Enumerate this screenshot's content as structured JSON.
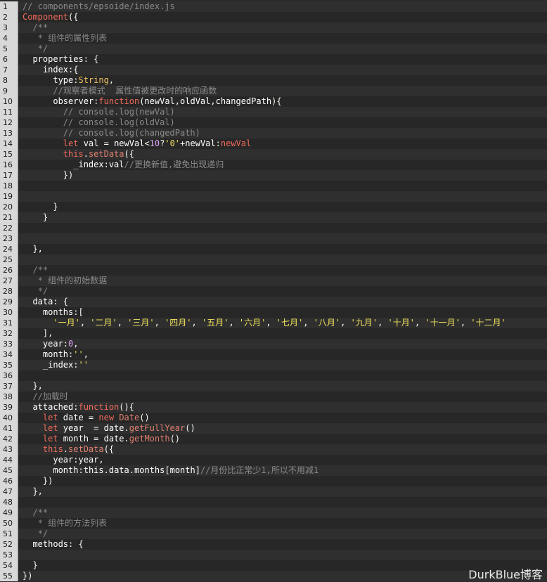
{
  "editor": {
    "lines": [
      {
        "n": "1",
        "tokens": [
          [
            "c",
            "// components/epsoide/index.js"
          ]
        ]
      },
      {
        "n": "2",
        "tokens": [
          [
            "k",
            "Component"
          ],
          [
            "p",
            "({"
          ]
        ]
      },
      {
        "n": "3",
        "tokens": [
          [
            "c",
            "  /**"
          ]
        ]
      },
      {
        "n": "4",
        "tokens": [
          [
            "c",
            "   * 组件的属性列表"
          ]
        ]
      },
      {
        "n": "5",
        "tokens": [
          [
            "c",
            "   */"
          ]
        ]
      },
      {
        "n": "6",
        "tokens": [
          [
            "v",
            "  properties"
          ],
          [
            "p",
            ": {"
          ]
        ]
      },
      {
        "n": "7",
        "tokens": [
          [
            "v",
            "    index"
          ],
          [
            "p",
            ":{"
          ]
        ]
      },
      {
        "n": "8",
        "tokens": [
          [
            "v",
            "      type"
          ],
          [
            "p",
            ":"
          ],
          [
            "t",
            "String"
          ],
          [
            "p",
            ","
          ]
        ]
      },
      {
        "n": "9",
        "tokens": [
          [
            "c",
            "      //观察者模式  属性值被更改时的响应函数"
          ]
        ]
      },
      {
        "n": "10",
        "tokens": [
          [
            "v",
            "      observer"
          ],
          [
            "p",
            ":"
          ],
          [
            "k",
            "function"
          ],
          [
            "p",
            "("
          ],
          [
            "v",
            "newVal"
          ],
          [
            "p",
            ","
          ],
          [
            "v",
            "oldVal"
          ],
          [
            "p",
            ","
          ],
          [
            "v",
            "changedPath"
          ],
          [
            "p",
            "){"
          ]
        ]
      },
      {
        "n": "11",
        "tokens": [
          [
            "c",
            "        // console.log(newVal)"
          ]
        ]
      },
      {
        "n": "12",
        "tokens": [
          [
            "c",
            "        // console.log(oldVal)"
          ]
        ]
      },
      {
        "n": "13",
        "tokens": [
          [
            "c",
            "        // console.log(changedPath)"
          ]
        ]
      },
      {
        "n": "14",
        "tokens": [
          [
            "k",
            "        let"
          ],
          [
            "v",
            " val"
          ],
          [
            "p",
            " = "
          ],
          [
            "v",
            "newVal"
          ],
          [
            "p",
            "<"
          ],
          [
            "n",
            "10"
          ],
          [
            "p",
            "?"
          ],
          [
            "s",
            "'0'"
          ],
          [
            "p",
            "+"
          ],
          [
            "v",
            "newVal"
          ],
          [
            "p",
            ":"
          ],
          [
            "k",
            "newVal"
          ]
        ]
      },
      {
        "n": "15",
        "tokens": [
          [
            "k",
            "        this"
          ],
          [
            "p",
            "."
          ],
          [
            "f",
            "setData"
          ],
          [
            "p",
            "({"
          ]
        ]
      },
      {
        "n": "16",
        "tokens": [
          [
            "v",
            "          _index"
          ],
          [
            "p",
            ":"
          ],
          [
            "v",
            "val"
          ],
          [
            "c",
            "//更换新值,避免出现递归"
          ]
        ]
      },
      {
        "n": "17",
        "tokens": [
          [
            "p",
            "        })"
          ]
        ]
      },
      {
        "n": "18",
        "tokens": []
      },
      {
        "n": "19",
        "tokens": []
      },
      {
        "n": "20",
        "tokens": [
          [
            "p",
            "      }"
          ]
        ]
      },
      {
        "n": "21",
        "tokens": [
          [
            "p",
            "    }"
          ]
        ]
      },
      {
        "n": "22",
        "tokens": []
      },
      {
        "n": "23",
        "tokens": []
      },
      {
        "n": "24",
        "tokens": [
          [
            "p",
            "  },"
          ]
        ]
      },
      {
        "n": "25",
        "tokens": []
      },
      {
        "n": "26",
        "tokens": [
          [
            "c",
            "  /**"
          ]
        ]
      },
      {
        "n": "27",
        "tokens": [
          [
            "c",
            "   * 组件的初始数据"
          ]
        ]
      },
      {
        "n": "28",
        "tokens": [
          [
            "c",
            "   */"
          ]
        ]
      },
      {
        "n": "29",
        "tokens": [
          [
            "v",
            "  data"
          ],
          [
            "p",
            ": {"
          ]
        ]
      },
      {
        "n": "30",
        "tokens": [
          [
            "v",
            "    months"
          ],
          [
            "p",
            ":["
          ]
        ]
      },
      {
        "n": "31",
        "tokens": [
          [
            "s",
            "      '一月'"
          ],
          [
            "p",
            ", "
          ],
          [
            "s",
            "'二月'"
          ],
          [
            "p",
            ", "
          ],
          [
            "s",
            "'三月'"
          ],
          [
            "p",
            ", "
          ],
          [
            "s",
            "'四月'"
          ],
          [
            "p",
            ", "
          ],
          [
            "s",
            "'五月'"
          ],
          [
            "p",
            ", "
          ],
          [
            "s",
            "'六月'"
          ],
          [
            "p",
            ", "
          ],
          [
            "s",
            "'七月'"
          ],
          [
            "p",
            ", "
          ],
          [
            "s",
            "'八月'"
          ],
          [
            "p",
            ", "
          ],
          [
            "s",
            "'九月'"
          ],
          [
            "p",
            ", "
          ],
          [
            "s",
            "'十月'"
          ],
          [
            "p",
            ", "
          ],
          [
            "s",
            "'十一月'"
          ],
          [
            "p",
            ", "
          ],
          [
            "s",
            "'十二月'"
          ]
        ]
      },
      {
        "n": "32",
        "tokens": [
          [
            "p",
            "    ],"
          ]
        ]
      },
      {
        "n": "33",
        "tokens": [
          [
            "v",
            "    year"
          ],
          [
            "p",
            ":"
          ],
          [
            "n",
            "0"
          ],
          [
            "p",
            ","
          ]
        ]
      },
      {
        "n": "34",
        "tokens": [
          [
            "v",
            "    month"
          ],
          [
            "p",
            ":"
          ],
          [
            "s",
            "''"
          ],
          [
            "p",
            ","
          ]
        ]
      },
      {
        "n": "35",
        "tokens": [
          [
            "v",
            "    _index"
          ],
          [
            "p",
            ":"
          ],
          [
            "s",
            "''"
          ]
        ]
      },
      {
        "n": "36",
        "tokens": []
      },
      {
        "n": "37",
        "tokens": [
          [
            "p",
            "  },"
          ]
        ]
      },
      {
        "n": "38",
        "tokens": [
          [
            "c",
            "  //加载时"
          ]
        ]
      },
      {
        "n": "39",
        "tokens": [
          [
            "v",
            "  attached"
          ],
          [
            "p",
            ":"
          ],
          [
            "k",
            "function"
          ],
          [
            "p",
            "(){"
          ]
        ]
      },
      {
        "n": "40",
        "tokens": [
          [
            "k",
            "    let"
          ],
          [
            "v",
            " date"
          ],
          [
            "p",
            " = "
          ],
          [
            "k",
            "new"
          ],
          [
            "p",
            " "
          ],
          [
            "f",
            "Date"
          ],
          [
            "p",
            "()"
          ]
        ]
      },
      {
        "n": "41",
        "tokens": [
          [
            "k",
            "    let"
          ],
          [
            "v",
            " year"
          ],
          [
            "p",
            "  = "
          ],
          [
            "v",
            "date"
          ],
          [
            "p",
            "."
          ],
          [
            "f",
            "getFullYear"
          ],
          [
            "p",
            "()"
          ]
        ]
      },
      {
        "n": "42",
        "tokens": [
          [
            "k",
            "    let"
          ],
          [
            "v",
            " month"
          ],
          [
            "p",
            " = "
          ],
          [
            "v",
            "date"
          ],
          [
            "p",
            "."
          ],
          [
            "f",
            "getMonth"
          ],
          [
            "p",
            "()"
          ]
        ]
      },
      {
        "n": "43",
        "tokens": [
          [
            "k",
            "    this"
          ],
          [
            "p",
            "."
          ],
          [
            "f",
            "setData"
          ],
          [
            "p",
            "({"
          ]
        ]
      },
      {
        "n": "44",
        "tokens": [
          [
            "v",
            "      year"
          ],
          [
            "p",
            ":"
          ],
          [
            "v",
            "year"
          ],
          [
            "p",
            ","
          ]
        ]
      },
      {
        "n": "45",
        "tokens": [
          [
            "v",
            "      month"
          ],
          [
            "p",
            ":"
          ],
          [
            "v",
            "this"
          ],
          [
            "p",
            "."
          ],
          [
            "v",
            "data"
          ],
          [
            "p",
            "."
          ],
          [
            "v",
            "months"
          ],
          [
            "p",
            "["
          ],
          [
            "v",
            "month"
          ],
          [
            "p",
            "]"
          ],
          [
            "c",
            "//月份比正常少1,所以不用减1"
          ]
        ]
      },
      {
        "n": "46",
        "tokens": [
          [
            "p",
            "    })"
          ]
        ]
      },
      {
        "n": "47",
        "tokens": [
          [
            "p",
            "  },"
          ]
        ]
      },
      {
        "n": "48",
        "tokens": []
      },
      {
        "n": "49",
        "tokens": [
          [
            "c",
            "  /**"
          ]
        ]
      },
      {
        "n": "50",
        "tokens": [
          [
            "c",
            "   * 组件的方法列表"
          ]
        ]
      },
      {
        "n": "51",
        "tokens": [
          [
            "c",
            "   */"
          ]
        ]
      },
      {
        "n": "52",
        "tokens": [
          [
            "v",
            "  methods"
          ],
          [
            "p",
            ": {"
          ]
        ]
      },
      {
        "n": "53",
        "tokens": []
      },
      {
        "n": "54",
        "tokens": [
          [
            "p",
            "  }"
          ]
        ]
      },
      {
        "n": "55",
        "tokens": [
          [
            "p",
            "})"
          ]
        ]
      }
    ]
  },
  "watermark": "DurkBlue博客",
  "colors": {
    "background": "#2b2b2b",
    "gutter": "#d8d8d8",
    "comment": "#8a8a8a",
    "keyword": "#f06a5a",
    "string": "#f2e25b",
    "number": "#d9a0f0"
  }
}
